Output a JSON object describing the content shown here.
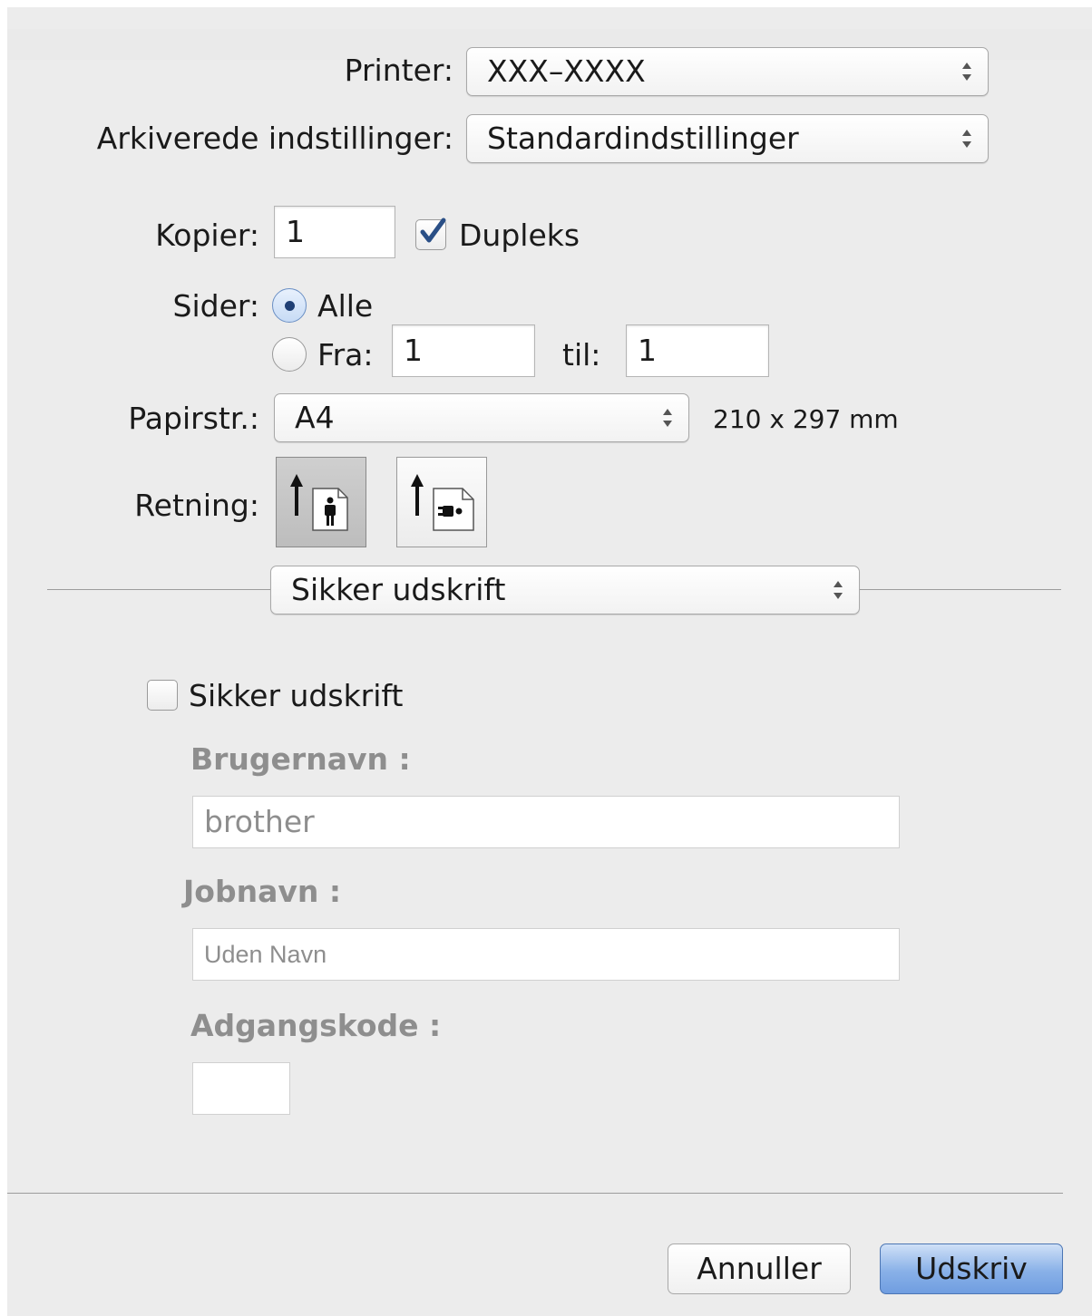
{
  "printer": {
    "label": "Printer:",
    "value": "XXX–XXXX"
  },
  "presets": {
    "label": "Arkiverede indstillinger:",
    "value": "Standardindstillinger"
  },
  "copies": {
    "label": "Kopier:",
    "value": "1",
    "duplex_label": "Dupleks",
    "duplex_checked": true
  },
  "pages": {
    "label": "Sider:",
    "all_label": "Alle",
    "from_label": "Fra:",
    "from_value": "1",
    "to_label": "til:",
    "to_value": "1",
    "selected": "all"
  },
  "paper": {
    "label": "Papirstr.:",
    "value": "A4",
    "size_text": "210 x 297 mm"
  },
  "orientation": {
    "label": "Retning:",
    "selected": "portrait"
  },
  "panel": {
    "value": "Sikker udskrift"
  },
  "secure": {
    "checkbox_label": "Sikker udskrift",
    "checked": false,
    "username_label": "Brugernavn :",
    "username_value": "brother",
    "jobname_label": "Jobnavn :",
    "jobname_value": "Uden Navn",
    "password_label": "Adgangskode :",
    "password_value": ""
  },
  "buttons": {
    "cancel": "Annuller",
    "print": "Udskriv"
  },
  "colors": {
    "accent": "#6f9de0",
    "checkmark": "#2a4f86"
  }
}
